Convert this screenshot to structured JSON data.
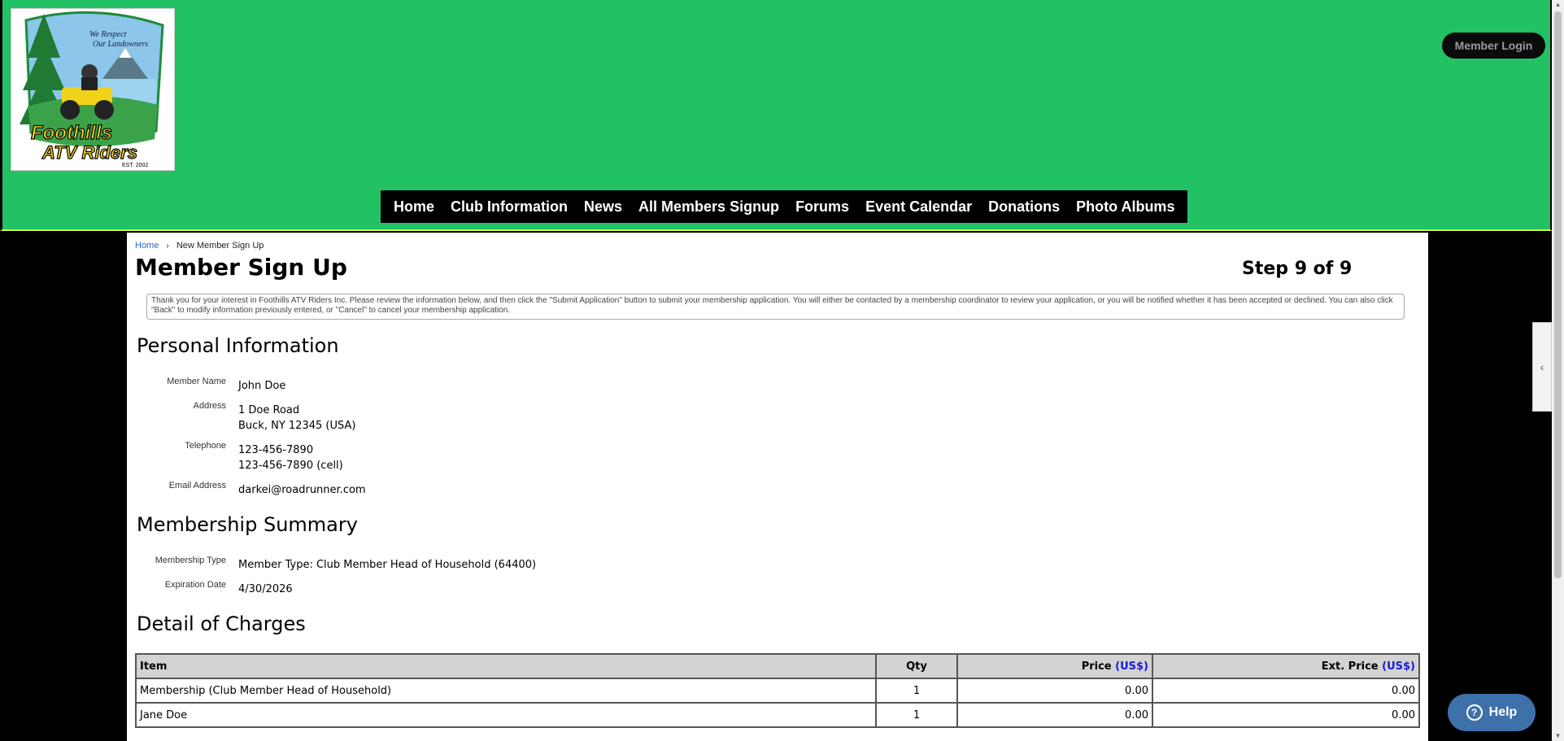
{
  "header": {
    "logo": {
      "top_text_1": "We Respect",
      "top_text_2": "Our Landowners",
      "brand_1": "Foothills",
      "brand_2": "ATV Riders",
      "est": "EST. 2002",
      "colors": {
        "green": "#1f8b3a",
        "yellow": "#f1d21b",
        "sky": "#8cc6ea"
      }
    },
    "login_label": "Member Login",
    "nav": [
      "Home",
      "Club Information",
      "News",
      "All Members Signup",
      "Forums",
      "Event Calendar",
      "Donations",
      "Photo Albums"
    ]
  },
  "breadcrumb": {
    "home": "Home",
    "current": "New Member Sign Up"
  },
  "page": {
    "title": "Member Sign Up",
    "step": "Step 9 of 9",
    "notice": "Thank you for your interest in Foothills ATV Riders Inc. Please review the information below, and then click the \"Submit Application\" button to submit your membership application. You will either be contacted by a membership coordinator to review your application, or you will be notified whether it has been accepted or declined. You can also click \"Back\" to modify information previously entered, or \"Cancel\" to cancel your membership application."
  },
  "personal": {
    "heading": "Personal Information",
    "member_name_label": "Member Name",
    "member_name": "John Doe",
    "address_label": "Address",
    "address_line1": "1 Doe Road",
    "address_line2": "Buck, NY 12345 (USA)",
    "telephone_label": "Telephone",
    "phone1": "123-456-7890",
    "phone2": "123-456-7890 (cell)",
    "email_label": "Email Address",
    "email": "darkei@roadrunner.com"
  },
  "membership": {
    "heading": "Membership Summary",
    "type_label": "Membership Type",
    "type": "Member Type: Club Member Head of Household (64400)",
    "expiration_label": "Expiration Date",
    "expiration": "4/30/2026"
  },
  "charges": {
    "heading": "Detail of Charges",
    "columns": {
      "item": "Item",
      "qty": "Qty",
      "price": "Price",
      "ext_price": "Ext. Price",
      "currency": "(US$)"
    },
    "rows": [
      {
        "item": "Membership (Club Member Head of Household)",
        "qty": "1",
        "price": "0.00",
        "ext": "0.00"
      },
      {
        "item": "Jane Doe",
        "qty": "1",
        "price": "0.00",
        "ext": "0.00"
      }
    ]
  },
  "help_label": "Help",
  "icons": {
    "side_tab": "chevron-left-icon",
    "help": "question-circle-icon"
  }
}
